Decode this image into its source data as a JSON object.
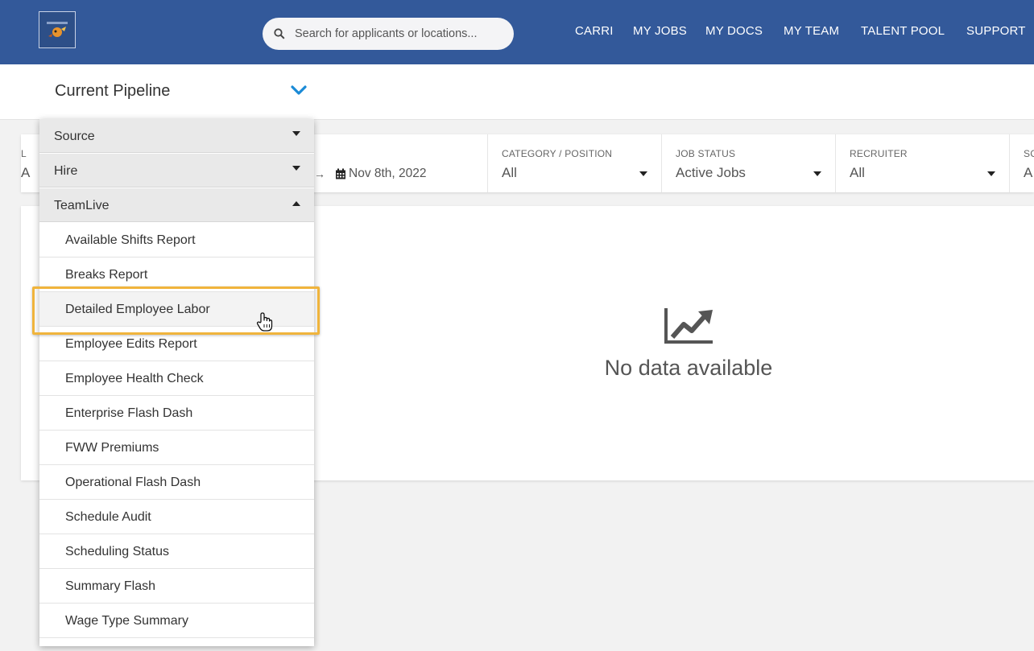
{
  "search": {
    "placeholder": "Search for applicants or locations..."
  },
  "nav": [
    "CARRI",
    "MY JOBS",
    "MY DOCS",
    "MY TEAM",
    "TALENT POOL",
    "SUPPORT"
  ],
  "pipeline": {
    "title": "Current Pipeline"
  },
  "filters": {
    "partial_left_label": "L",
    "partial_left_value": "A",
    "date_end": "Nov 8th, 2022",
    "category": {
      "label": "CATEGORY / POSITION",
      "value": "All"
    },
    "job_status": {
      "label": "JOB STATUS",
      "value": "Active Jobs"
    },
    "recruiter": {
      "label": "RECRUITER",
      "value": "All"
    },
    "partial_right_label": "SC",
    "partial_right_value": "A"
  },
  "chart": {
    "empty_text": "No data available"
  },
  "menu": {
    "groups": [
      "Source",
      "Hire",
      "TeamLive"
    ],
    "items": [
      "Available Shifts Report",
      "Breaks Report",
      "Detailed Employee Labor",
      "Employee Edits Report",
      "Employee Health Check",
      "Enterprise Flash Dash",
      "FWW Premiums",
      "Operational Flash Dash",
      "Schedule Audit",
      "Scheduling Status",
      "Summary Flash",
      "Wage Type Summary"
    ]
  },
  "colors": {
    "nav_bg": "#33599a",
    "accent": "#1a8ad6",
    "highlight": "#f0b43c"
  }
}
